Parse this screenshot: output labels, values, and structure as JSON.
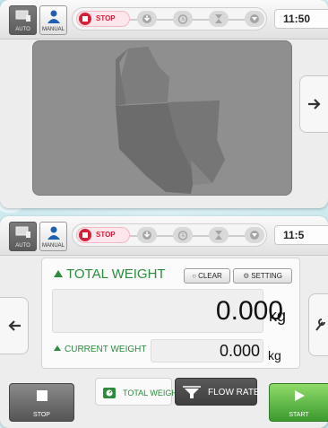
{
  "status_bar": {
    "auto_label": "AUTO",
    "manual_label": "MANUAL",
    "stop_label": "STOP",
    "time_top": "11:50",
    "time_bottom": "11:5"
  },
  "weigh": {
    "total_weight_title": "TOTAL WEIGHT",
    "clear_label": "CLEAR",
    "setting_label": "SETTING",
    "total_value": "0.000",
    "total_unit": "kg",
    "current_weight_title": "CURRENT WEIGHT",
    "current_value": "0.000",
    "current_unit": "kg"
  },
  "bottom_bar": {
    "stop_label": "STOP",
    "tab_total_label": "TOTAL WEIGHT",
    "tab_flow_label": "FLOW RATE",
    "start_label": "START"
  },
  "colors": {
    "accent_green": "#2c8b3c",
    "stop_red": "#d6203a",
    "start_green": "#3c9a2f"
  },
  "icons": {
    "auto": "monitor-icon",
    "manual": "person-icon",
    "step1": "download-icon",
    "step2": "timer-icon",
    "step3": "hourglass-icon",
    "step4": "funnel-icon",
    "next": "arrow-right-icon",
    "prev": "arrow-left-icon",
    "tool": "wrench-icon"
  }
}
